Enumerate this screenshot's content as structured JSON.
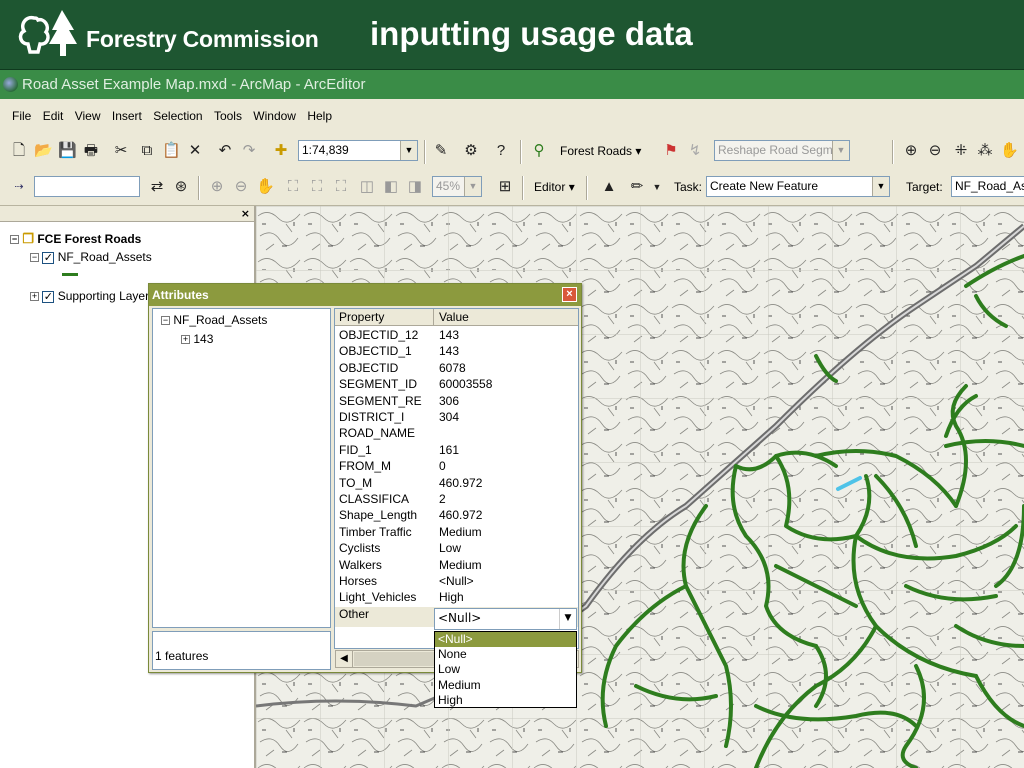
{
  "slide": {
    "brand": "Forestry Commission",
    "title": "inputting usage data",
    "banner_color": "#1e5631"
  },
  "window": {
    "title": "Road Asset Example Map.mxd - ArcMap - ArcEditor"
  },
  "menu": [
    "File",
    "Edit",
    "View",
    "Insert",
    "Selection",
    "Tools",
    "Window",
    "Help"
  ],
  "toolbar": {
    "scale": "1:74,839",
    "layer_label": "Forest Roads",
    "reshape_label": "Reshape Road Segmen",
    "zoom_pct": "45%",
    "editor_label": "Editor",
    "task_label": "Task:",
    "task_value": "Create New Feature",
    "target_label": "Target:",
    "target_value": "NF_Road_Asse"
  },
  "toc": {
    "group": "FCE Forest Roads",
    "layer1": "NF_Road_Assets",
    "layer2": "Supporting Layer"
  },
  "attributes": {
    "title": "Attributes",
    "tree_root": "NF_Road_Assets",
    "tree_child": "143",
    "feature_count": "1 features",
    "col_property": "Property",
    "col_value": "Value",
    "rows": [
      {
        "p": "OBJECTID_12",
        "v": "143"
      },
      {
        "p": "OBJECTID_1",
        "v": "143"
      },
      {
        "p": "OBJECTID",
        "v": "6078"
      },
      {
        "p": "SEGMENT_ID",
        "v": "60003558"
      },
      {
        "p": "SEGMENT_RE",
        "v": "306"
      },
      {
        "p": "DISTRICT_I",
        "v": "304"
      },
      {
        "p": "ROAD_NAME",
        "v": ""
      },
      {
        "p": "FID_1",
        "v": "161"
      },
      {
        "p": "FROM_M",
        "v": "0"
      },
      {
        "p": "TO_M",
        "v": "460.972"
      },
      {
        "p": "CLASSIFICA",
        "v": "2"
      },
      {
        "p": "Shape_Length",
        "v": "460.972"
      },
      {
        "p": "Timber Traffic",
        "v": "Medium"
      },
      {
        "p": "Cyclists",
        "v": "Low"
      },
      {
        "p": "Walkers",
        "v": "Medium"
      },
      {
        "p": "Horses",
        "v": "<Null>"
      },
      {
        "p": "Light_Vehicles",
        "v": "High"
      },
      {
        "p": "Other",
        "v": "<Null>"
      }
    ],
    "other_value": "<Null>",
    "dropdown_options": [
      "<Null>",
      "None",
      "Low",
      "Medium",
      "High"
    ],
    "dropdown_selected": "<Null>"
  },
  "road_color": "#2e7d1e",
  "highlight_color": "#4fc3e8"
}
